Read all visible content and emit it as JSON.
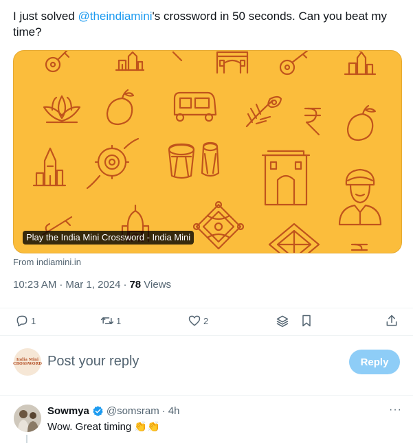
{
  "tweet": {
    "text_before": "I just solved ",
    "mention": "@theindiamini",
    "text_after": "'s crossword in 50 seconds. Can you beat my time?"
  },
  "card": {
    "title": "Play the India Mini Crossword - India Mini",
    "from": "From indiamini.in",
    "bg_color": "#fbbd3c",
    "icon_color": "#c0541c",
    "icons": [
      "sitar-icon",
      "temple-icon",
      "rupee-icon",
      "gateway-icon",
      "lotus-icon",
      "mango-icon",
      "auto-rickshaw-icon",
      "peacock-feather-icon",
      "rakhi-icon",
      "tabla-icon",
      "india-gate-icon",
      "turban-man-icon",
      "taj-mahal-icon",
      "kolam-icon"
    ]
  },
  "meta": {
    "time": "10:23 AM",
    "sep1": "·",
    "date": "Mar 1, 2024",
    "sep2": "·",
    "views_count": "78",
    "views_label": "Views"
  },
  "actions": {
    "replies": "1",
    "reposts": "1",
    "likes": "2"
  },
  "compose": {
    "avatar_text_1": "India Mini",
    "avatar_text_2": "CROSSWORD",
    "placeholder": "Post your reply",
    "button": "Reply"
  },
  "reply": {
    "name": "Sowmya",
    "handle": "@somsram",
    "sep": "·",
    "time": "4h",
    "text": "Wow. Great timing 👏👏",
    "more": "···"
  },
  "colors": {
    "accent": "#1d9bf0",
    "muted": "#536471",
    "reply_button": "#8ecdf7"
  }
}
